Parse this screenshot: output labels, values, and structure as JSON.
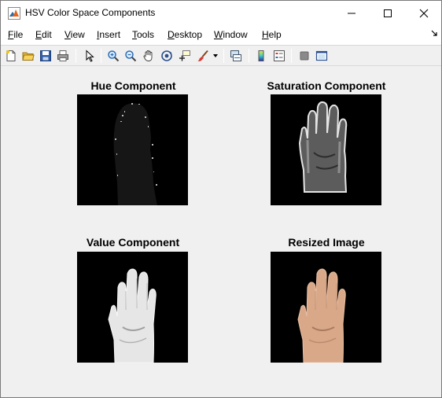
{
  "window": {
    "title": "HSV Color Space Components"
  },
  "menu": [
    {
      "accel": "F",
      "rest": "ile"
    },
    {
      "accel": "E",
      "rest": "dit"
    },
    {
      "accel": "V",
      "rest": "iew"
    },
    {
      "accel": "I",
      "rest": "nsert"
    },
    {
      "accel": "T",
      "rest": "ools"
    },
    {
      "accel": "D",
      "rest": "esktop"
    },
    {
      "accel": "W",
      "rest": "indow"
    },
    {
      "accel": "H",
      "rest": "elp"
    }
  ],
  "toolbar_icons": [
    "new-figure-icon",
    "open-file-icon",
    "save-figure-icon",
    "print-figure-icon",
    "edit-plot-arrow-icon",
    "zoom-in-icon",
    "zoom-out-icon",
    "pan-hand-icon",
    "rotate-3d-icon",
    "data-cursor-icon",
    "brush-icon",
    "brush-dropdown-icon",
    "link-plot-icon",
    "insert-colorbar-icon",
    "insert-legend-icon",
    "hide-plot-tools-icon",
    "show-plot-tools-icon"
  ],
  "panels": [
    {
      "title": "Hue Component",
      "kind": "hue"
    },
    {
      "title": "Saturation Component",
      "kind": "saturation"
    },
    {
      "title": "Value Component",
      "kind": "value"
    },
    {
      "title": "Resized Image",
      "kind": "resized"
    }
  ],
  "colors": {
    "figure_bg": "#f0f0f0",
    "axes_bg": "#000000",
    "hue_hand": "#161616",
    "skin": "#d9a889",
    "value_hand": "#e6e6e6",
    "saturation_hand": "#5a5a5a"
  }
}
